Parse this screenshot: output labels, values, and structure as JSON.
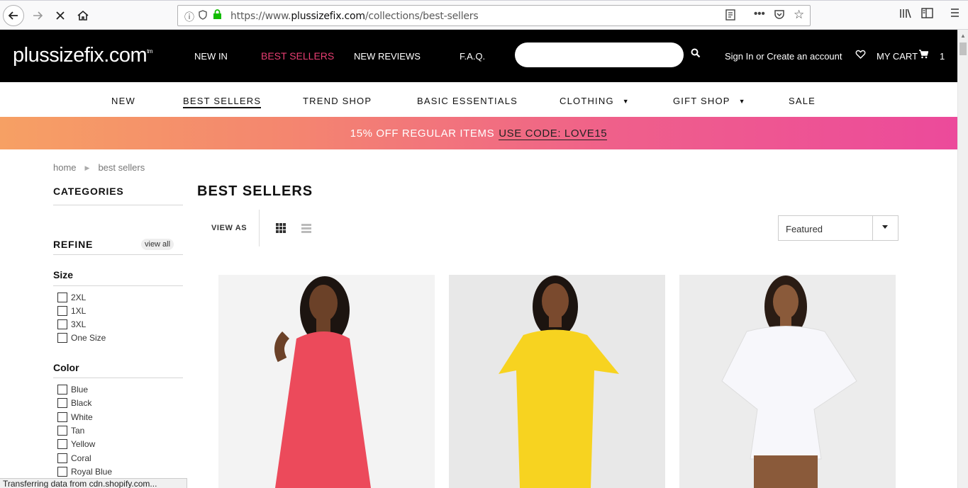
{
  "browser": {
    "url_prefix": "https://www.",
    "url_domain": "plussizefix.com",
    "url_path": "/collections/best-sellers"
  },
  "header": {
    "logo": "plussizefix.com",
    "logo_tm": "tm",
    "top_nav": [
      {
        "label": "NEW IN"
      },
      {
        "label": "BEST SELLERS"
      },
      {
        "label": "NEW REVIEWS"
      },
      {
        "label": "F.A.Q."
      }
    ],
    "search_placeholder": "",
    "account_label": "Sign In or Create an account",
    "cart_label": "MY CART",
    "cart_count": "1"
  },
  "main_nav": [
    {
      "label": "NEW"
    },
    {
      "label": "BEST SELLERS"
    },
    {
      "label": "TREND SHOP"
    },
    {
      "label": "BASIC ESSENTIALS"
    },
    {
      "label": "CLOTHING"
    },
    {
      "label": "GIFT SHOP"
    },
    {
      "label": "SALE"
    }
  ],
  "promo": {
    "text": "15% OFF REGULAR ITEMS",
    "code": "USE CODE: LOVE15"
  },
  "breadcrumb": {
    "home": "home",
    "current": "best sellers"
  },
  "sidebar": {
    "categories_heading": "CATEGORIES",
    "refine_heading": "REFINE",
    "view_all": "view all",
    "size_title": "Size",
    "sizes": [
      "2XL",
      "1XL",
      "3XL",
      "One Size"
    ],
    "color_title": "Color",
    "colors": [
      "Blue",
      "Black",
      "White",
      "Tan",
      "Yellow",
      "Coral",
      "Royal Blue"
    ]
  },
  "content": {
    "title": "BEST SELLERS",
    "view_as": "VIEW AS",
    "sort_value": "Featured"
  },
  "products": [
    {
      "dress_color": "#ec4a5b"
    },
    {
      "dress_color": "#f7d320"
    },
    {
      "dress_color": "#f7f7fb"
    }
  ],
  "status_bar": "Transferring data from cdn.shopify.com..."
}
